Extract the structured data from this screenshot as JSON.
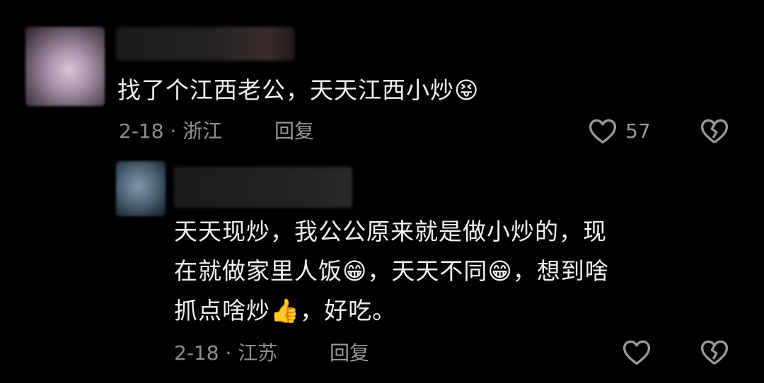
{
  "comments": [
    {
      "text": "找了个江西老公，天天江西小炒😝",
      "date_location": "2-18 · 浙江",
      "reply_label": "回复",
      "like_count": "57",
      "like_icon": "heart-outline-icon",
      "dislike_icon": "broken-heart-icon"
    },
    {
      "text": "天天现炒，我公公原来就是做小炒的，现\n在就做家里人饭😁，天天不同😁，想到啥\n抓点啥炒👍，好吃。",
      "date_location": "2-18 · 江苏",
      "reply_label": "回复",
      "like_icon": "heart-outline-icon",
      "dislike_icon": "broken-heart-icon"
    }
  ],
  "colors": {
    "background": "#000000",
    "text": "#f2f2f2",
    "meta": "#8e8e8e"
  }
}
